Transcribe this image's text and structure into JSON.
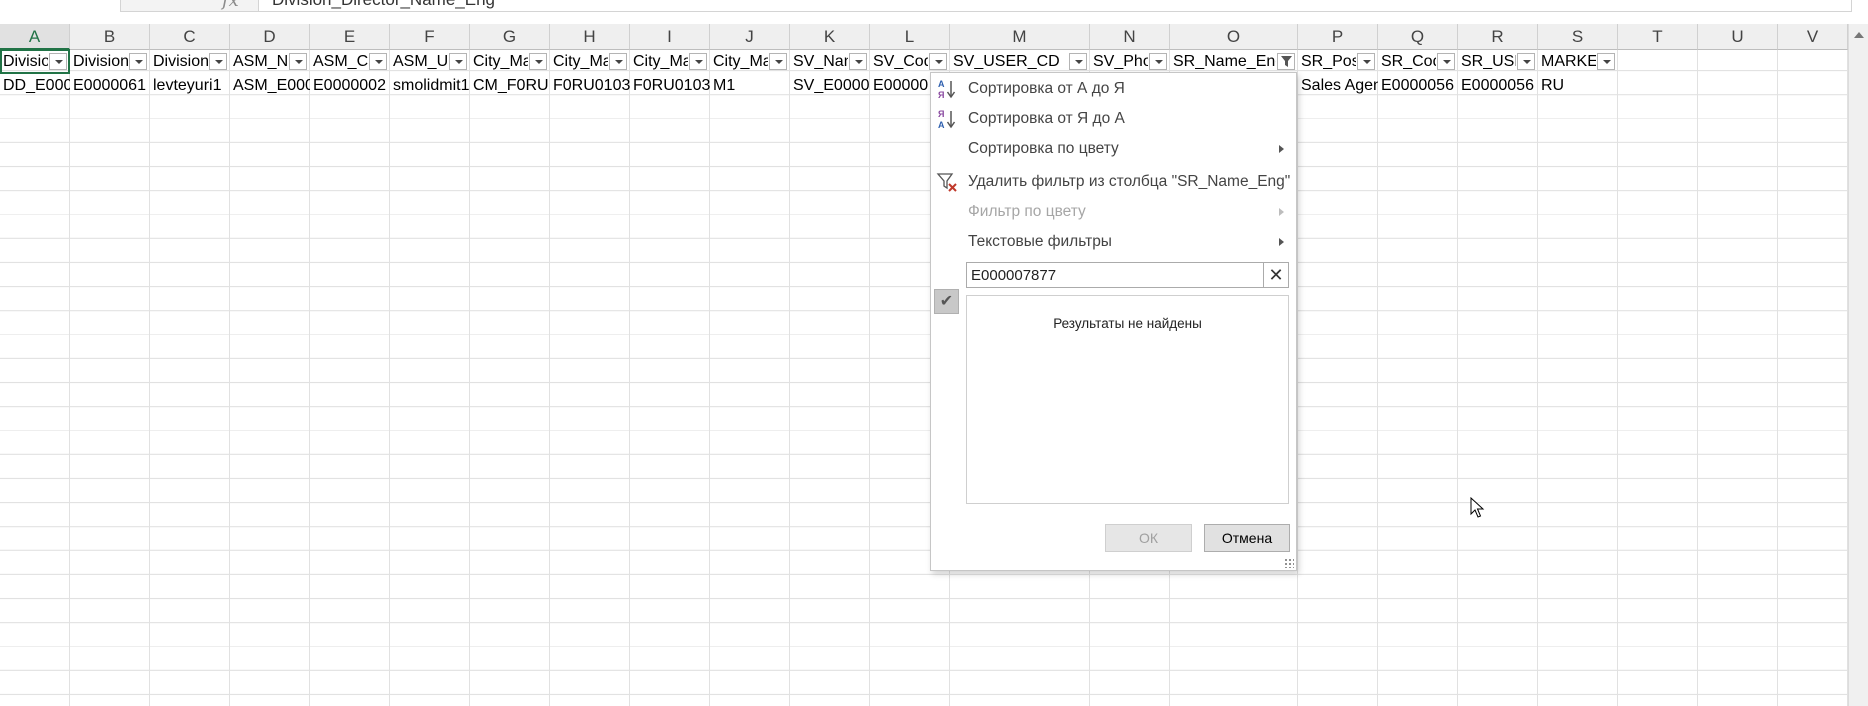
{
  "formula_bar": {
    "content": "Division_Director_Name_Eng"
  },
  "columns": [
    "A",
    "B",
    "C",
    "D",
    "E",
    "F",
    "G",
    "H",
    "I",
    "J",
    "K",
    "L",
    "M",
    "N",
    "O",
    "P",
    "Q",
    "R",
    "S",
    "T",
    "U",
    "V"
  ],
  "header_row": [
    "Division",
    "Division",
    "Division",
    "ASM_N",
    "ASM_C",
    "ASM_U",
    "City_Ma",
    "City_Ma",
    "City_Ma",
    "City_Ma",
    "SV_Nan",
    "SV_Cod",
    "SV_USER_CD",
    "SV_Pho",
    "SR_Name_Eng",
    "SR_Pos",
    "SR_Cod",
    "SR_USE",
    "MARKET",
    "",
    "",
    ""
  ],
  "data_row": [
    "DD_E0000",
    "E0000061",
    "levteyuri1",
    "ASM_E000",
    "E0000002",
    "smolidmit1",
    "CM_F0RU",
    "F0RU0103",
    "F0RU0103",
    "M1",
    "SV_E0000",
    "E00000",
    "",
    "",
    "",
    "Sales Agen",
    "E0000056",
    "E0000056",
    "RU",
    "",
    "",
    ""
  ],
  "active_cell": "A1",
  "filter_menu": {
    "column_name": "SR_Name_Eng",
    "items": [
      {
        "label": "Сортировка от А до Я",
        "icon": "sort-ascending-icon",
        "disabled": false,
        "submenu": false
      },
      {
        "label": "Сортировка от Я до А",
        "icon": "sort-descending-icon",
        "disabled": false,
        "submenu": false
      },
      {
        "label": "Сортировка по цвету",
        "icon": "",
        "disabled": false,
        "submenu": true
      },
      {
        "label": "Удалить фильтр из столбца \"SR_Name_Eng\"",
        "icon": "clear-filter-icon",
        "disabled": false,
        "submenu": false
      },
      {
        "label": "Фильтр по цвету",
        "icon": "",
        "disabled": true,
        "submenu": true
      },
      {
        "label": "Текстовые фильтры",
        "icon": "",
        "disabled": false,
        "submenu": true
      }
    ],
    "search": {
      "value": "E000007877",
      "clear_label": "✕"
    },
    "results_message": "Результаты не найдены",
    "ok_label": "ОК",
    "cancel_label": "Отмена"
  },
  "colors": {
    "accent": "#217346",
    "sort_icon_blue": "#2e5fae",
    "sort_icon_purple": "#8a4aa0",
    "clear_filter_red": "#c0392b"
  }
}
